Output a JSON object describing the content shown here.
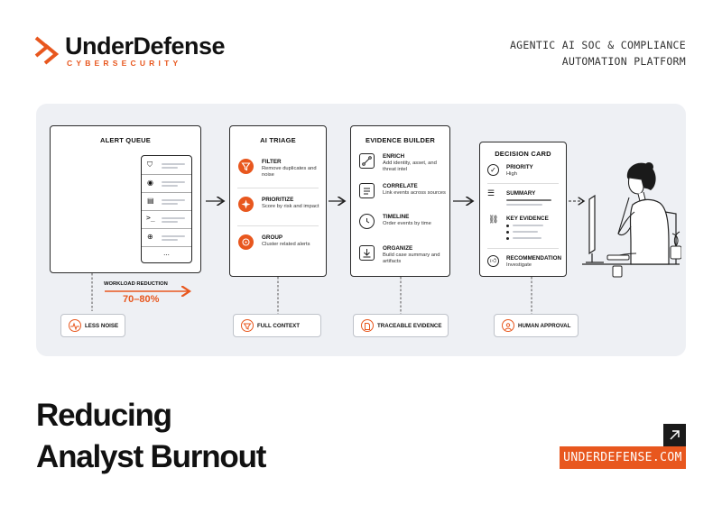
{
  "brand": {
    "name": "UnderDefense",
    "subtitle": "CYBERSECURITY"
  },
  "tagline": {
    "line1": "AGENTIC AI SOC & COMPLIANCE",
    "line2": "AUTOMATION PLATFORM"
  },
  "diagram": {
    "alert_queue": {
      "title": "ALERT QUEUE",
      "more": "...",
      "workload_label": "WORKLOAD REDUCTION",
      "workload_value": "70–80%"
    },
    "ai_triage": {
      "title": "AI TRIAGE",
      "items": [
        {
          "title": "FILTER",
          "desc": "Remove duplicates and noise"
        },
        {
          "title": "PRIORITIZE",
          "desc": "Score by risk and impact"
        },
        {
          "title": "GROUP",
          "desc": "Cluster related alerts"
        }
      ]
    },
    "evidence_builder": {
      "title": "EVIDENCE BUILDER",
      "items": [
        {
          "title": "ENRICH",
          "desc": "Add identity, asset, and threat intel"
        },
        {
          "title": "CORRELATE",
          "desc": "Link events across sources"
        },
        {
          "title": "TIMELINE",
          "desc": "Order events by time"
        },
        {
          "title": "ORGANIZE",
          "desc": "Build case summary and artifacts"
        }
      ]
    },
    "decision_card": {
      "title": "DECISION CARD",
      "items": [
        {
          "title": "PRIORITY",
          "desc": "High"
        },
        {
          "title": "SUMMARY",
          "desc": ""
        },
        {
          "title": "KEY EVIDENCE",
          "desc": ""
        },
        {
          "title": "RECOMMENDATION",
          "desc": "Investigate"
        }
      ]
    },
    "outcomes": [
      "LESS NOISE",
      "FULL CONTEXT",
      "TRACEABLE EVIDENCE",
      "HUMAN APPROVAL"
    ]
  },
  "headline": {
    "line1": "Reducing",
    "line2": "Analyst Burnout"
  },
  "cta": {
    "label": "UNDERDEFENSE.COM",
    "icon": "arrow-up-right-icon"
  },
  "colors": {
    "accent": "#e8571e",
    "panel": "#eef0f4",
    "ink": "#111111"
  }
}
